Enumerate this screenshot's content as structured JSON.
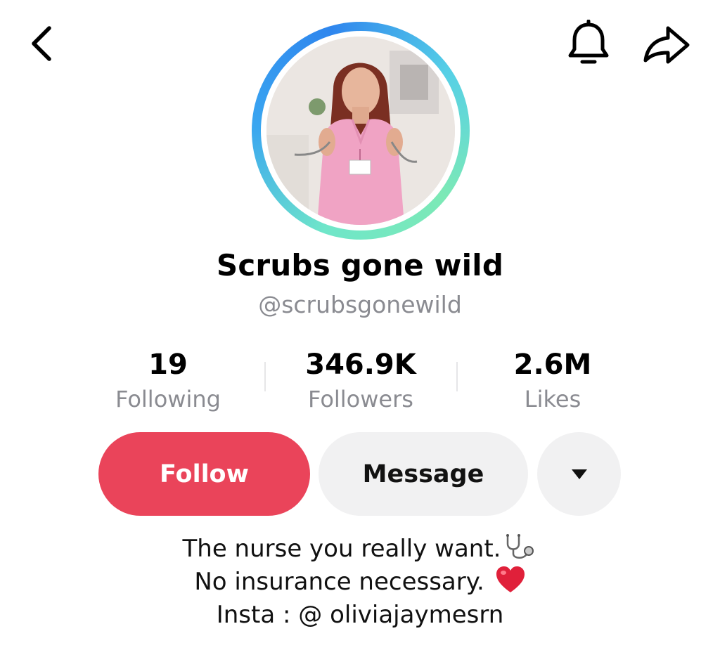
{
  "header": {
    "back_icon": "chevron-left-icon",
    "notification_icon": "bell-icon",
    "share_icon": "share-arrow-icon"
  },
  "profile": {
    "display_name": "Scrubs gone wild",
    "handle": "@scrubsgonewild",
    "avatar_ring_colors": [
      "#2f86ee",
      "#6fe6c9"
    ]
  },
  "stats": [
    {
      "value": "19",
      "label": "Following"
    },
    {
      "value": "346.9K",
      "label": "Followers"
    },
    {
      "value": "2.6M",
      "label": "Likes"
    }
  ],
  "actions": {
    "follow_label": "Follow",
    "message_label": "Message",
    "more_icon": "caret-down-icon"
  },
  "bio": {
    "lines": [
      "The nurse you really want.",
      "No insurance necessary.",
      "Insta : @ oliviajaymesrn"
    ],
    "line1_emoji_icon": "stethoscope-icon",
    "line2_emoji_icon": "red-heart-icon"
  },
  "colors": {
    "follow_button": "#ea445a",
    "secondary_button": "#f1f1f2",
    "muted_text": "#8a8b91"
  }
}
